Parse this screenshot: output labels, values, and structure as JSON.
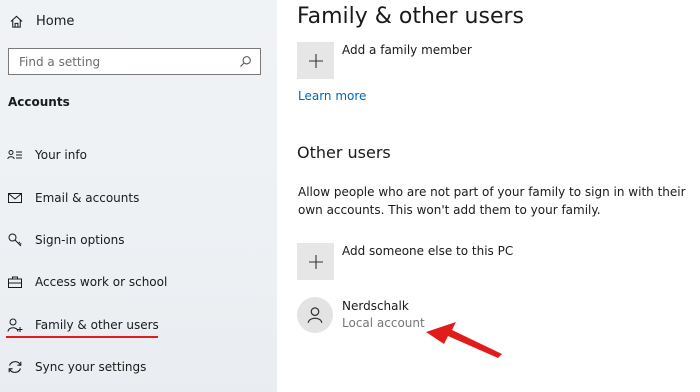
{
  "sidebar": {
    "home_label": "Home",
    "search_placeholder": "Find a setting",
    "section_title": "Accounts",
    "items": [
      {
        "label": "Your info",
        "icon": "person-list-icon"
      },
      {
        "label": "Email & accounts",
        "icon": "envelope-icon"
      },
      {
        "label": "Sign-in options",
        "icon": "key-icon"
      },
      {
        "label": "Access work or school",
        "icon": "briefcase-icon"
      },
      {
        "label": "Family & other users",
        "icon": "person-add-icon",
        "selected": true
      },
      {
        "label": "Sync your settings",
        "icon": "sync-icon"
      }
    ]
  },
  "main": {
    "title": "Family & other users",
    "add_family_label": "Add a family member",
    "learn_more": "Learn more",
    "other_users_title": "Other users",
    "other_users_desc": "Allow people who are not part of your family to sign in with their own accounts. This won't add them to your family.",
    "add_someone_label": "Add someone else to this PC",
    "users": [
      {
        "name": "Nerdschalk",
        "type": "Local account"
      }
    ]
  },
  "colors": {
    "link": "#0067b8",
    "annotation_red": "#e21b1b",
    "sidebar_bg": "#eef1f4"
  }
}
